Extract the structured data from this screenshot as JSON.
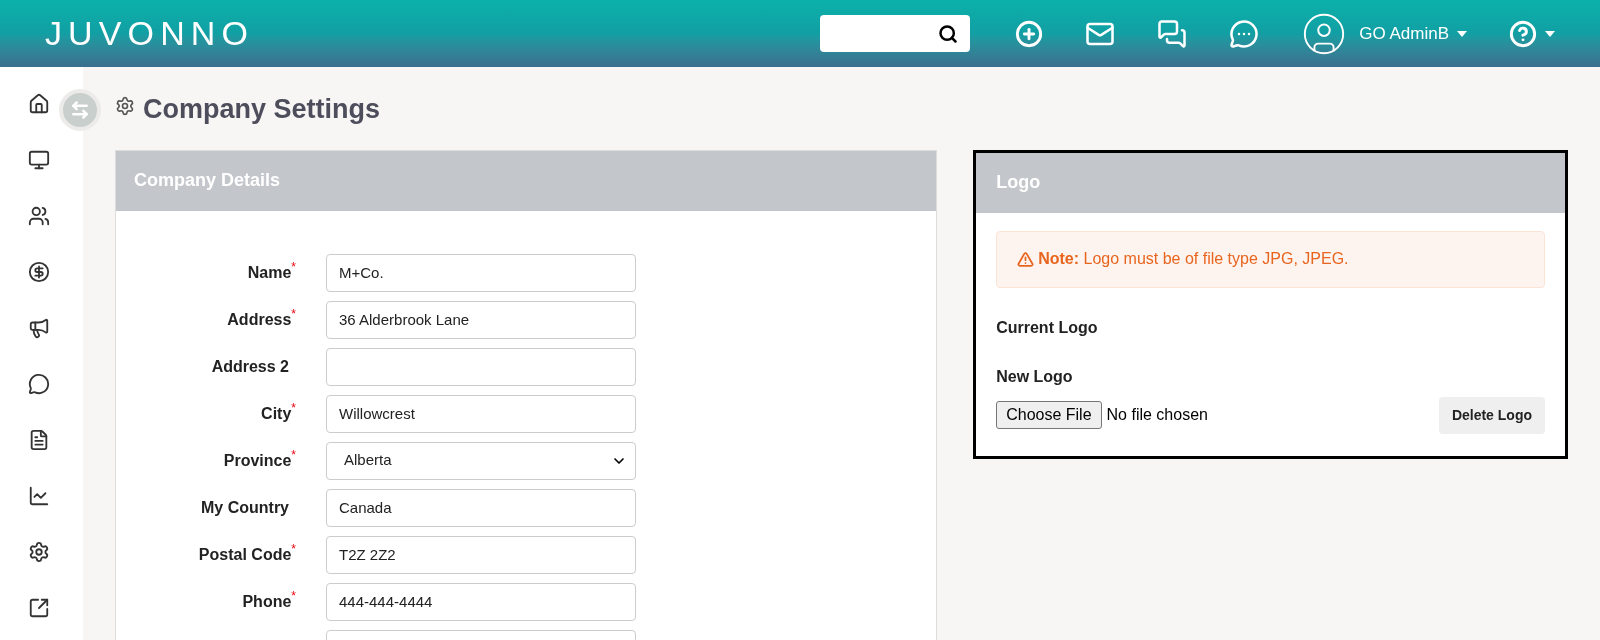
{
  "header": {
    "logo": "JUVONNO",
    "user": "GO AdminB"
  },
  "page": {
    "title": "Company Settings"
  },
  "company_details": {
    "title": "Company Details",
    "required_mark": "*",
    "fields": [
      {
        "label": "Name",
        "required": true,
        "kind": "text",
        "value": "M+Co."
      },
      {
        "label": "Address",
        "required": true,
        "kind": "text",
        "value": "36 Alderbrook Lane"
      },
      {
        "label": "Address 2",
        "required": false,
        "kind": "text"
      },
      {
        "label": "City",
        "required": true,
        "kind": "text",
        "value": "Willowcrest"
      },
      {
        "label": "Province",
        "required": true,
        "kind": "select",
        "value": "Alberta"
      },
      {
        "label": "My Country",
        "required": false,
        "kind": "text",
        "value": "Canada"
      },
      {
        "label": "Postal Code",
        "required": true,
        "kind": "text",
        "value": "T2Z 2Z2"
      },
      {
        "label": "Phone",
        "required": true,
        "kind": "text",
        "value": "444-444-4444"
      }
    ]
  },
  "logo_panel": {
    "title": "Logo",
    "note": "**Note:** Logo must be of file type JPG, JPEG.",
    "current_label": "Current Logo",
    "new_label": "New Logo",
    "choose_button": "Choose File",
    "file_status": "No file chosen",
    "delete_button": "Delete Logo"
  }
}
